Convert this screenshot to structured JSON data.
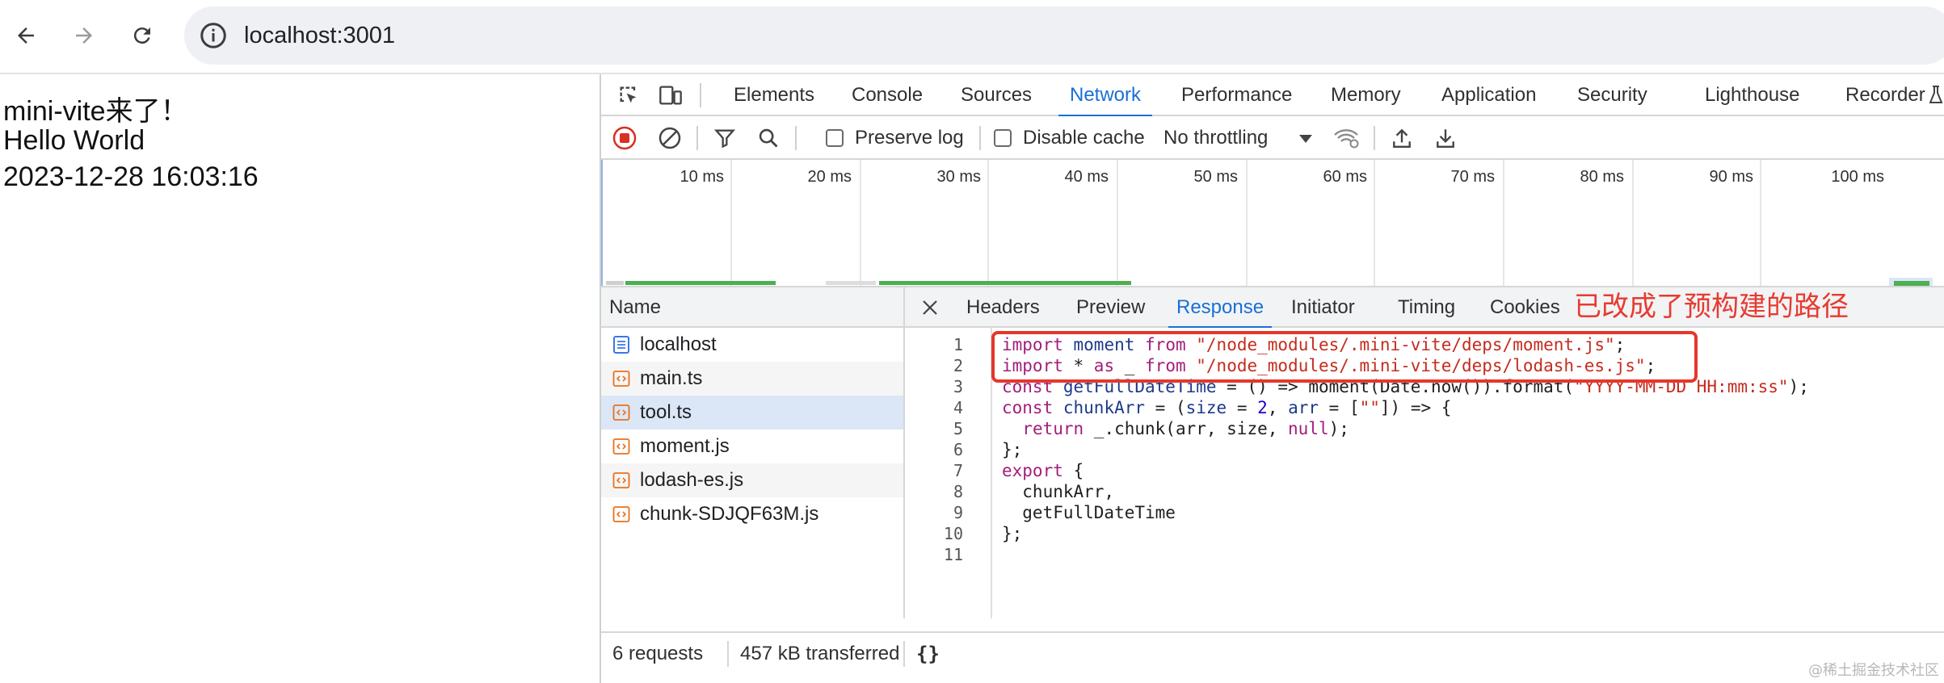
{
  "browser": {
    "url": "localhost:3001",
    "back_icon": "arrow-left-icon",
    "forward_icon": "arrow-right-icon",
    "reload_icon": "reload-icon",
    "info_icon": "info-circle-icon"
  },
  "page": {
    "lines": [
      "mini-vite来了！",
      "Hello World",
      "2023-12-28 16:03:16"
    ]
  },
  "devtools": {
    "tabs": [
      "Elements",
      "Console",
      "Sources",
      "Network",
      "Performance",
      "Memory",
      "Application",
      "Security",
      "Lighthouse",
      "Recorder"
    ],
    "active_tab": "Network",
    "toolbar": {
      "preserve_log": "Preserve log",
      "disable_cache": "Disable cache",
      "throttling": "No throttling"
    },
    "overview_ticks": [
      "10 ms",
      "20 ms",
      "30 ms",
      "40 ms",
      "50 ms",
      "60 ms",
      "70 ms",
      "80 ms",
      "90 ms",
      "100 ms"
    ],
    "requests_header": "Name",
    "requests": [
      {
        "name": "localhost",
        "icon": "document-icon"
      },
      {
        "name": "main.ts",
        "icon": "script-icon"
      },
      {
        "name": "tool.ts",
        "icon": "script-icon"
      },
      {
        "name": "moment.js",
        "icon": "script-icon"
      },
      {
        "name": "lodash-es.js",
        "icon": "script-icon"
      },
      {
        "name": "chunk-SDJQF63M.js",
        "icon": "script-icon"
      }
    ],
    "selected_request": "tool.ts",
    "detail_tabs": [
      "Headers",
      "Preview",
      "Response",
      "Initiator",
      "Timing",
      "Cookies"
    ],
    "active_detail_tab": "Response",
    "annotation": "已改成了预构建的路径",
    "line_numbers": [
      "1",
      "2",
      "3",
      "4",
      "5",
      "6",
      "7",
      "8",
      "9",
      "10",
      "11"
    ],
    "code": [
      [
        [
          "kw",
          "import"
        ],
        [
          "t",
          " "
        ],
        [
          "id",
          "moment"
        ],
        [
          "t",
          " "
        ],
        [
          "kw",
          "from"
        ],
        [
          "t",
          " "
        ],
        [
          "str",
          "\"/node_modules/.mini-vite/deps/moment.js\""
        ],
        [
          "t",
          ";"
        ]
      ],
      [
        [
          "kw",
          "import"
        ],
        [
          "t",
          " * "
        ],
        [
          "kw",
          "as"
        ],
        [
          "t",
          " _ "
        ],
        [
          "kw",
          "from"
        ],
        [
          "t",
          " "
        ],
        [
          "str",
          "\"/node_modules/.mini-vite/deps/lodash-es.js\""
        ],
        [
          "t",
          ";"
        ]
      ],
      [
        [
          "kw",
          "const"
        ],
        [
          "t",
          " "
        ],
        [
          "id",
          "getFullDateTime"
        ],
        [
          "t",
          " = () => moment(Date.now()).format("
        ],
        [
          "str",
          "\"YYYY-MM-DD HH:mm:ss\""
        ],
        [
          "t",
          ");"
        ]
      ],
      [
        [
          "kw",
          "const"
        ],
        [
          "t",
          " "
        ],
        [
          "id",
          "chunkArr"
        ],
        [
          "t",
          " = ("
        ],
        [
          "id",
          "size"
        ],
        [
          "t",
          " = "
        ],
        [
          "num",
          "2"
        ],
        [
          "t",
          ", "
        ],
        [
          "id",
          "arr"
        ],
        [
          "t",
          " = ["
        ],
        [
          "str",
          "\"\""
        ],
        [
          "t",
          "]) => {"
        ]
      ],
      [
        [
          "t",
          "  "
        ],
        [
          "kw",
          "return"
        ],
        [
          "t",
          " _.chunk(arr, size, "
        ],
        [
          "kw",
          "null"
        ],
        [
          "t",
          ");"
        ]
      ],
      [
        [
          "t",
          "};"
        ]
      ],
      [
        [
          "kw",
          "export"
        ],
        [
          "t",
          " {"
        ]
      ],
      [
        [
          "t",
          "  chunkArr,"
        ]
      ],
      [
        [
          "t",
          "  getFullDateTime"
        ]
      ],
      [
        [
          "t",
          "};"
        ]
      ],
      [
        [
          "t",
          ""
        ]
      ]
    ],
    "status": {
      "requests": "6 requests",
      "transferred": "457 kB transferred",
      "format": "{}"
    },
    "watermark": "@稀土掘金技术社区",
    "colors": {
      "accent": "#1a6fd6",
      "annotation": "#e83a30",
      "record": "#d93025",
      "timeline_green": "#4caf50"
    }
  }
}
